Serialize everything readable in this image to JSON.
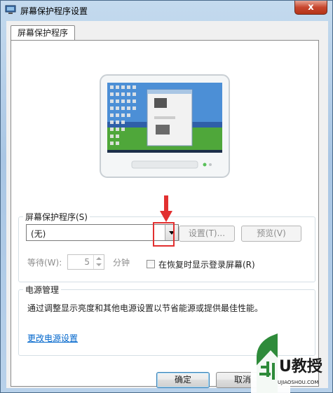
{
  "window": {
    "title": "屏幕保护程序设置",
    "close_label": "x"
  },
  "tab": {
    "label": "屏幕保护程序"
  },
  "screensaver": {
    "group_label": "屏幕保护程序(S)",
    "selected": "(无)",
    "settings_button": "设置(T)...",
    "preview_button": "预览(V)",
    "wait_label": "等待(W):",
    "wait_value": "5",
    "minutes_label": "分钟",
    "resume_checkbox_label": "在恢复时显示登录屏幕(R)",
    "resume_checked": false
  },
  "power": {
    "group_label": "电源管理",
    "description": "通过调整显示亮度和其他电源设置以节省能源或提供最佳性能。",
    "link": "更改电源设置"
  },
  "footer": {
    "ok_button": "确定",
    "cancel_button": "取消"
  },
  "watermark": {
    "text": "U教授",
    "url_text": "UJIAOSHOU.COM"
  },
  "colors": {
    "accent_red": "#e23030",
    "link": "#0066cc",
    "title_bar": "#a9c6e4"
  }
}
